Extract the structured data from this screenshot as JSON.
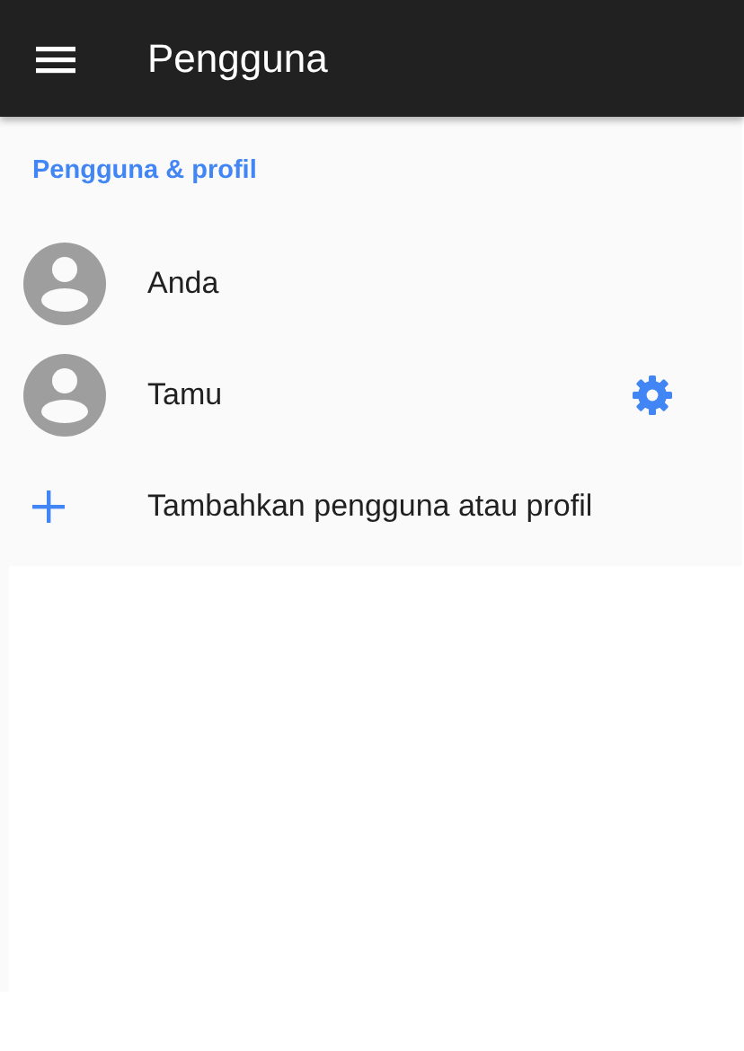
{
  "app_bar": {
    "title": "Pengguna"
  },
  "section": {
    "title": "Pengguna & profil"
  },
  "users": [
    {
      "name": "Anda",
      "settings": false
    },
    {
      "name": "Tamu",
      "settings": true
    }
  ],
  "add_action": {
    "label": "Tambahkan pengguna atau profil"
  }
}
